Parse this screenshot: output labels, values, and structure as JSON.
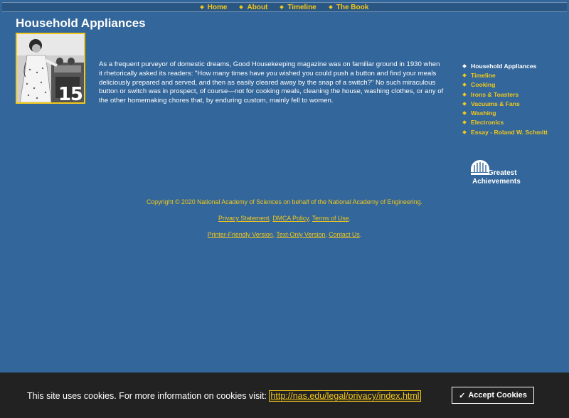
{
  "topnav": [
    {
      "label": "Home"
    },
    {
      "label": "About"
    },
    {
      "label": "Timeline"
    },
    {
      "label": "The Book"
    }
  ],
  "page": {
    "title": "Household Appliances",
    "badge_number": "15",
    "intro": "As a frequent purveyor of domestic dreams, Good Housekeeping magazine was on familiar ground in 1930 when it rhetorically asked its readers: \"How many times have you wished you could push a button and find your meals deliciously prepared and served, and then as easily cleared away by the snap of a switch?\" No such miraculous button or switch was in prospect, of course—not for cooking meals, cleaning the house, washing clothes, or any of the other homemaking chores that, by enduring custom, mainly fell to women."
  },
  "sidenav": [
    {
      "label": "Household Appliances"
    },
    {
      "label": "Timeline"
    },
    {
      "label": "Cooking"
    },
    {
      "label": "Irons & Toasters"
    },
    {
      "label": "Vacuums & Fans"
    },
    {
      "label": "Washing"
    },
    {
      "label": "Electronics"
    },
    {
      "label": "Essay - Roland W. Schmitt"
    }
  ],
  "logo": {
    "line1": "Greatest",
    "line2": "Achievements"
  },
  "footer": {
    "copyright": "Copyright © 2020 National Academy of Sciences on behalf of the National Academy of Engineering.",
    "links1": [
      "Privacy Statement",
      "DMCA Policy",
      "Terms of Use"
    ],
    "links2": [
      "Printer-Friendly Version",
      "Text-Only Version",
      "Contact Us"
    ]
  },
  "cookie": {
    "message": "This site uses cookies. For more information on cookies visit:",
    "link": "http://nas.edu/legal/privacy/index.html",
    "button": "Accept Cookies"
  },
  "colors": {
    "background": "#33669a",
    "accent": "#f2c81b",
    "banner": "#222222"
  }
}
